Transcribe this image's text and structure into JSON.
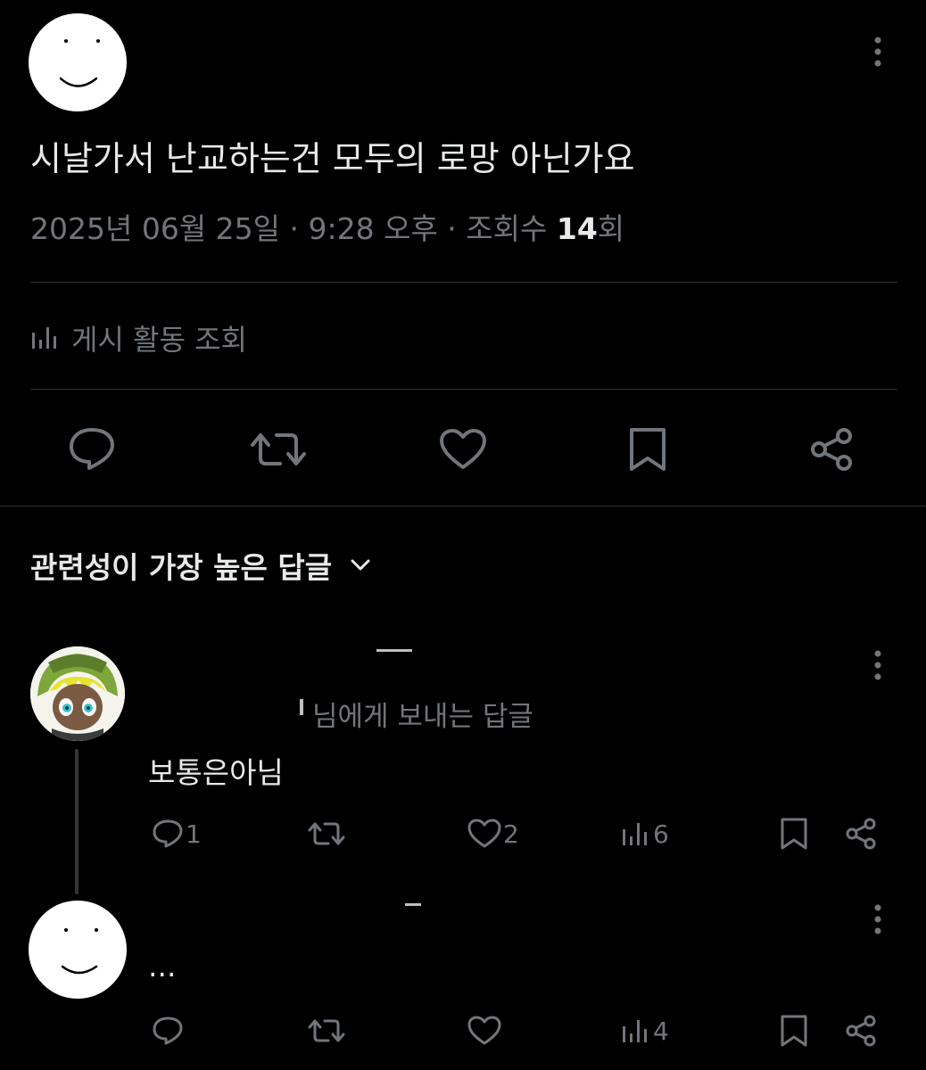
{
  "post": {
    "text": "시날가서 난교하는건 모두의 로망 아닌가요",
    "date": "2025년 06월 25일 · 9:28 오후 · 조회수 ",
    "views_count": "14",
    "views_suffix": "회",
    "activity_label": "게시 활동 조회"
  },
  "sort": {
    "label": "관련성이 가장 높은 답글"
  },
  "replies": [
    {
      "reply_to_suffix": "님에게 보내는 답글",
      "text": "보통은아님",
      "stats": {
        "replies": "1",
        "likes": "2",
        "views": "6"
      }
    },
    {
      "text": "...",
      "stats": {
        "views": "4"
      }
    }
  ],
  "colors": {
    "background": "#000000",
    "text": "#e7e9ea",
    "muted": "#71767b",
    "divider": "#2f3336"
  },
  "icons": {
    "reply": "reply-bubble-icon",
    "repost": "repost-arrows-icon",
    "like": "heart-icon",
    "bookmark": "bookmark-icon",
    "share": "share-nodes-icon",
    "views": "bar-chart-icon",
    "more": "vertical-dots-icon"
  }
}
